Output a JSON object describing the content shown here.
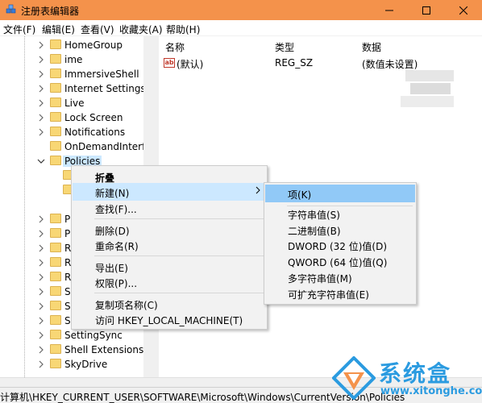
{
  "window": {
    "title": "注册表编辑器",
    "accent": "#f4924b"
  },
  "menubar": [
    {
      "label": "文件(F)"
    },
    {
      "label": "编辑(E)"
    },
    {
      "label": "查看(V)"
    },
    {
      "label": "收藏夹(A)"
    },
    {
      "label": "帮助(H)"
    }
  ],
  "tree": {
    "items": [
      {
        "label": "HomeGroup"
      },
      {
        "label": "ime"
      },
      {
        "label": "ImmersiveShell"
      },
      {
        "label": "Internet Settings"
      },
      {
        "label": "Live"
      },
      {
        "label": "Lock Screen"
      },
      {
        "label": "Notifications"
      },
      {
        "label": "OnDemandInterfac"
      },
      {
        "label": "Policies"
      },
      {
        "label": "P"
      },
      {
        "label": "P"
      },
      {
        "label": "R"
      },
      {
        "label": "R"
      },
      {
        "label": "R"
      },
      {
        "label": "S"
      },
      {
        "label": "S"
      },
      {
        "label": "S"
      },
      {
        "label": "SettingSync"
      },
      {
        "label": "Shell Extensions"
      },
      {
        "label": "SkyDrive"
      }
    ]
  },
  "list": {
    "headers": {
      "name": "名称",
      "type": "类型",
      "data": "数据"
    },
    "rows": [
      {
        "name": "(默认)",
        "type": "REG_SZ",
        "data": "(数值未设置)",
        "icon": "string-value-icon"
      }
    ]
  },
  "context_menu": {
    "items": [
      {
        "label": "折叠",
        "bold": true
      },
      {
        "label": "新建(N)",
        "submenu": true
      },
      {
        "label": "查找(F)..."
      },
      {
        "label": "删除(D)"
      },
      {
        "label": "重命名(R)"
      },
      {
        "label": "导出(E)"
      },
      {
        "label": "权限(P)..."
      },
      {
        "label": "复制项名称(C)"
      },
      {
        "label": "访问 HKEY_LOCAL_MACHINE(T)"
      }
    ]
  },
  "submenu": {
    "items": [
      {
        "label": "项(K)"
      },
      {
        "label": "字符串值(S)"
      },
      {
        "label": "二进制值(B)"
      },
      {
        "label": "DWORD (32 位)值(D)"
      },
      {
        "label": "QWORD (64 位)值(Q)"
      },
      {
        "label": "多字符串值(M)"
      },
      {
        "label": "可扩充字符串值(E)"
      }
    ]
  },
  "statusbar": {
    "path": "计算机\\HKEY_CURRENT_USER\\SOFTWARE\\Microsoft\\Windows\\CurrentVersion\\Policies"
  },
  "watermark": {
    "cn": "系统盒",
    "url": "www.xitonghe.com",
    "color": "#2b9be0"
  }
}
